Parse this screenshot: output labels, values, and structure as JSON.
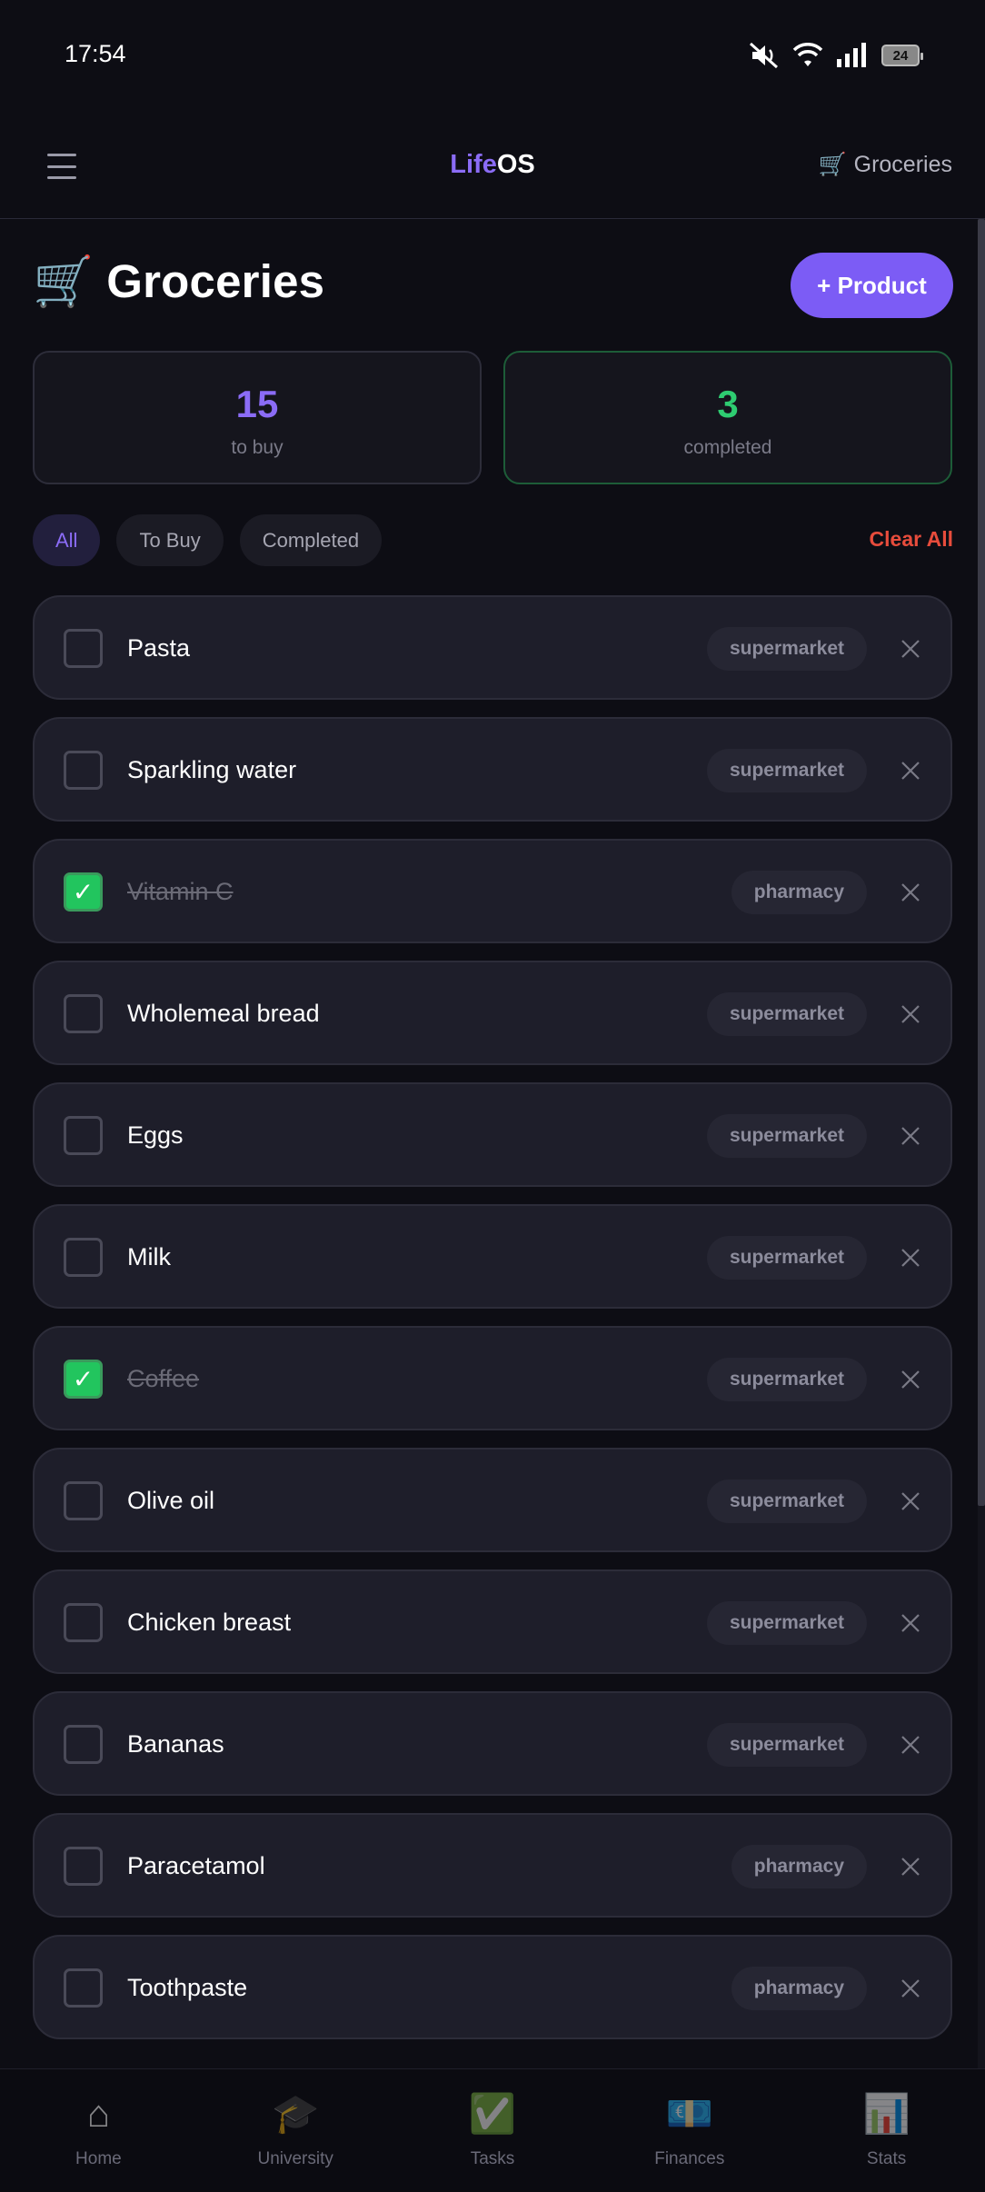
{
  "status_bar": {
    "time": "17:54",
    "battery": "24"
  },
  "header": {
    "brand_part1": "Life",
    "brand_part2": "OS",
    "current_section": "Groceries",
    "current_section_icon": "🛒"
  },
  "page": {
    "title": "Groceries",
    "title_icon": "🛒",
    "add_button": "+ Product"
  },
  "stats": {
    "to_buy": {
      "value": "15",
      "label": "to buy"
    },
    "completed": {
      "value": "3",
      "label": "completed"
    }
  },
  "filters": {
    "items": [
      "All",
      "To Buy",
      "Completed"
    ],
    "active": "All",
    "clear_all": "Clear All"
  },
  "items": [
    {
      "name": "Pasta",
      "tag": "supermarket",
      "checked": false
    },
    {
      "name": "Sparkling water",
      "tag": "supermarket",
      "checked": false
    },
    {
      "name": "Vitamin C",
      "tag": "pharmacy",
      "checked": true
    },
    {
      "name": "Wholemeal bread",
      "tag": "supermarket",
      "checked": false
    },
    {
      "name": "Eggs",
      "tag": "supermarket",
      "checked": false
    },
    {
      "name": "Milk",
      "tag": "supermarket",
      "checked": false
    },
    {
      "name": "Coffee",
      "tag": "supermarket",
      "checked": true
    },
    {
      "name": "Olive oil",
      "tag": "supermarket",
      "checked": false
    },
    {
      "name": "Chicken breast",
      "tag": "supermarket",
      "checked": false
    },
    {
      "name": "Bananas",
      "tag": "supermarket",
      "checked": false
    },
    {
      "name": "Paracetamol",
      "tag": "pharmacy",
      "checked": false
    },
    {
      "name": "Toothpaste",
      "tag": "pharmacy",
      "checked": false
    }
  ],
  "bottom_nav": [
    {
      "label": "Home",
      "icon": "⌂"
    },
    {
      "label": "University",
      "icon": "🎓"
    },
    {
      "label": "Tasks",
      "icon": "✅"
    },
    {
      "label": "Finances",
      "icon": "💶"
    },
    {
      "label": "Stats",
      "icon": "📊"
    }
  ],
  "colors": {
    "accent": "#7c5cf5",
    "success": "#22c55e",
    "danger": "#e74c3c",
    "background": "#0d0d14"
  }
}
